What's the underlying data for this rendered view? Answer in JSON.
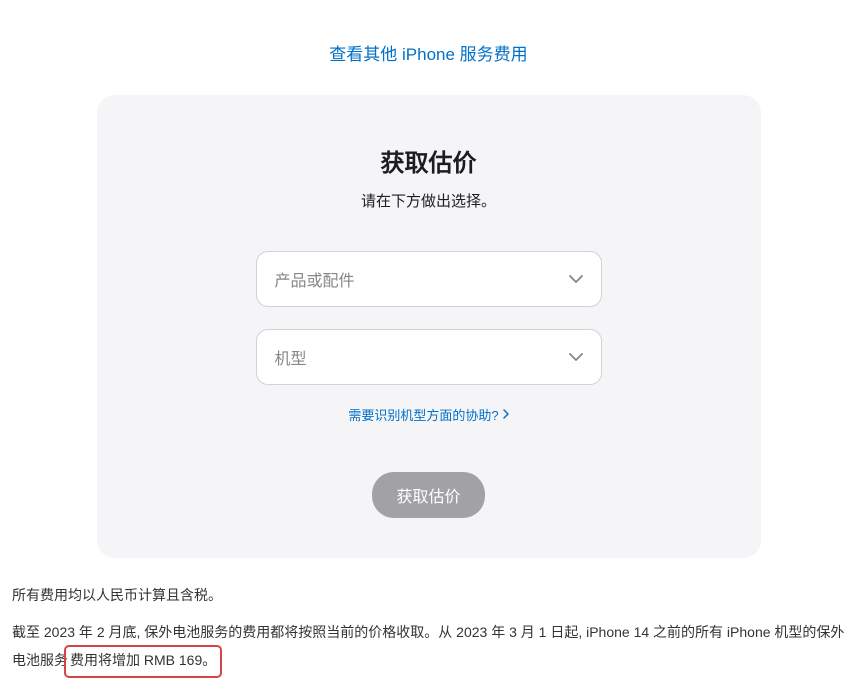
{
  "topLink": {
    "label": "查看其他 iPhone 服务费用"
  },
  "card": {
    "title": "获取估价",
    "subtitle": "请在下方做出选择。",
    "select1Placeholder": "产品或配件",
    "select2Placeholder": "机型",
    "helpLabel": "需要识别机型方面的协助?",
    "submitLabel": "获取估价"
  },
  "footer": {
    "note1": "所有费用均以人民币计算且含税。",
    "note2a": "截至 2023 年 2 月底, 保外电池服务的费用都将按照当前的价格收取。从 2023 年 3 月 1 日起, iPhone 14 之前的所有 iPhone 机型的保外电池服务",
    "note2b": "费用将增加 RMB 169。"
  }
}
